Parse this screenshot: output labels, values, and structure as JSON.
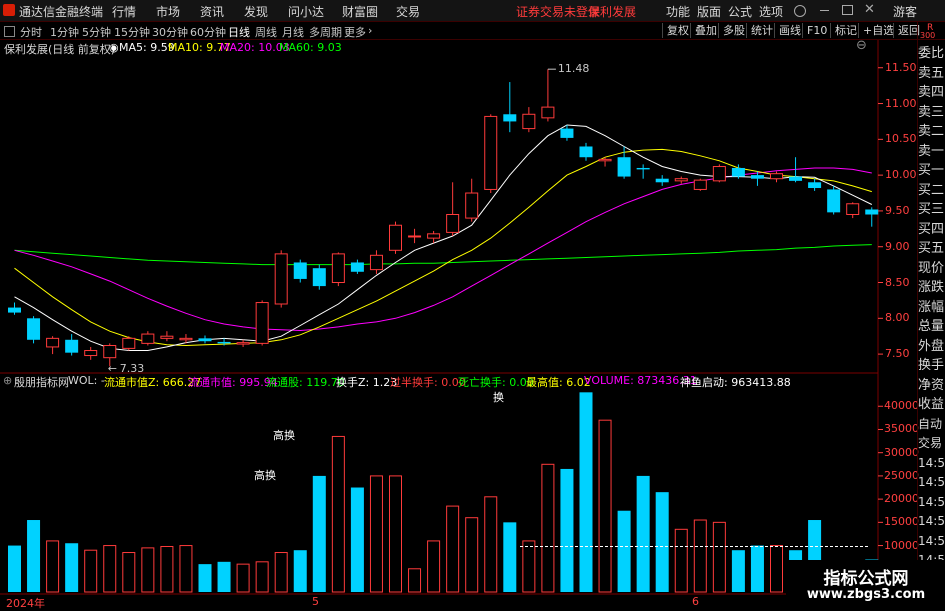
{
  "app": {
    "title": "通达信金融终端",
    "guest_label": "游客"
  },
  "menu": [
    "行情",
    "市场",
    "资讯",
    "发现",
    "问小达",
    "财富圈",
    "交易"
  ],
  "notice": {
    "text": "证券交易未登录",
    "stock": "保利发展"
  },
  "top_right_menu": [
    "功能",
    "版面",
    "公式",
    "选项"
  ],
  "toolbar": {
    "periods": [
      "分时",
      "1分钟",
      "5分钟",
      "15分钟",
      "30分钟",
      "60分钟",
      "日线",
      "周线",
      "月线",
      "多周期",
      "更多"
    ],
    "active_period": "日线",
    "right_buttons": [
      "复权",
      "叠加",
      "多股",
      "统计",
      "画线",
      "F10",
      "标记",
      "+自选",
      "返回"
    ]
  },
  "colors": {
    "up": "#ff3b3b",
    "down": "#00d2ff",
    "ma5": "#ffffff",
    "ma10": "#ffff00",
    "ma20": "#ff00ff",
    "ma60": "#00ff00"
  },
  "main_legend": {
    "title": "保利发展(日线 前复权)",
    "ma5": "MA5: 9.59",
    "ma10": "MA10: 9.77",
    "ma20": "MA20: 10.03",
    "ma60": "MA60: 9.03"
  },
  "price_marks": {
    "high": "11.48",
    "low": "7.33"
  },
  "right_panel": {
    "top_label": "R",
    "top_sub": "300",
    "labels": [
      "委比",
      "卖五",
      "卖四",
      "卖三",
      "卖二",
      "卖一",
      "买一",
      "买二",
      "买三",
      "买四",
      "买五",
      "现价",
      "涨跌",
      "涨幅",
      "总量",
      "外盘",
      "换手",
      "净资",
      "收益",
      "自动",
      "交易",
      "14:56",
      "14:56",
      "14:56",
      "14:56",
      "14:56",
      "14:56",
      "14:56",
      "14:56"
    ]
  },
  "indicator_legend": {
    "name": "殷朋指标网",
    "wol": "WOL: -",
    "items": [
      {
        "label": "流通市值Z: 666.27",
        "color": "#ffff00"
      },
      {
        "label": "流通市值: 995.94",
        "color": "#ff00ff"
      },
      {
        "label": "流通股: 119.70",
        "color": "#00ff00"
      },
      {
        "label": "换手Z: 1.23",
        "color": "#ffffff"
      },
      {
        "label": "过半换手: 0.00",
        "color": "#ff3b3b"
      },
      {
        "label": "死亡换手: 0.00",
        "color": "#00ff00"
      },
      {
        "label": "最高值: 6.02",
        "color": "#ffff00"
      },
      {
        "label": "VOLUME: 873436.31",
        "color": "#ff00ff"
      },
      {
        "label": "神鱼启动: 963413.88",
        "color": "#ffffff"
      }
    ]
  },
  "volume_labels": {
    "gaohuan1": "高换",
    "gaohuan2": "高换",
    "gaohuan3": "换"
  },
  "date_labels": [
    "2024年",
    "5",
    "6"
  ],
  "watermark": {
    "title": "指标公式网",
    "url": "www.zbgs3.com"
  },
  "chart_data": {
    "type": "candlestick",
    "price_ticks": [
      11.5,
      11.0,
      10.5,
      10.0,
      9.5,
      9.0,
      8.5,
      8.0,
      7.5
    ],
    "volume_ticks": [
      40000,
      35000,
      30000,
      25000,
      20000,
      15000,
      10000
    ],
    "candles": [
      {
        "o": 8.15,
        "h": 8.22,
        "l": 8.05,
        "c": 8.08
      },
      {
        "o": 8.0,
        "h": 8.03,
        "l": 7.65,
        "c": 7.7
      },
      {
        "o": 7.6,
        "h": 7.75,
        "l": 7.5,
        "c": 7.72
      },
      {
        "o": 7.7,
        "h": 7.78,
        "l": 7.48,
        "c": 7.52
      },
      {
        "o": 7.48,
        "h": 7.6,
        "l": 7.42,
        "c": 7.55
      },
      {
        "o": 7.45,
        "h": 7.65,
        "l": 7.33,
        "c": 7.62
      },
      {
        "o": 7.58,
        "h": 7.75,
        "l": 7.55,
        "c": 7.72
      },
      {
        "o": 7.65,
        "h": 7.82,
        "l": 7.62,
        "c": 7.78
      },
      {
        "o": 7.72,
        "h": 7.82,
        "l": 7.68,
        "c": 7.75
      },
      {
        "o": 7.7,
        "h": 7.78,
        "l": 7.65,
        "c": 7.72
      },
      {
        "o": 7.72,
        "h": 7.76,
        "l": 7.65,
        "c": 7.68
      },
      {
        "o": 7.67,
        "h": 7.72,
        "l": 7.62,
        "c": 7.65
      },
      {
        "o": 7.64,
        "h": 7.7,
        "l": 7.6,
        "c": 7.66
      },
      {
        "o": 7.65,
        "h": 8.25,
        "l": 7.62,
        "c": 8.22
      },
      {
        "o": 8.2,
        "h": 8.95,
        "l": 8.15,
        "c": 8.9
      },
      {
        "o": 8.78,
        "h": 8.82,
        "l": 8.5,
        "c": 8.55
      },
      {
        "o": 8.7,
        "h": 8.75,
        "l": 8.4,
        "c": 8.45
      },
      {
        "o": 8.5,
        "h": 8.92,
        "l": 8.45,
        "c": 8.9
      },
      {
        "o": 8.78,
        "h": 8.82,
        "l": 8.62,
        "c": 8.65
      },
      {
        "o": 8.68,
        "h": 8.95,
        "l": 8.62,
        "c": 8.88
      },
      {
        "o": 8.95,
        "h": 9.35,
        "l": 8.9,
        "c": 9.3
      },
      {
        "o": 9.15,
        "h": 9.25,
        "l": 9.05,
        "c": 9.15
      },
      {
        "o": 9.12,
        "h": 9.22,
        "l": 9.05,
        "c": 9.18
      },
      {
        "o": 9.2,
        "h": 9.9,
        "l": 9.15,
        "c": 9.45
      },
      {
        "o": 9.4,
        "h": 9.95,
        "l": 9.35,
        "c": 9.75
      },
      {
        "o": 9.8,
        "h": 10.85,
        "l": 9.75,
        "c": 10.82
      },
      {
        "o": 10.85,
        "h": 11.3,
        "l": 10.6,
        "c": 10.75
      },
      {
        "o": 10.65,
        "h": 10.95,
        "l": 10.6,
        "c": 10.85
      },
      {
        "o": 10.8,
        "h": 11.48,
        "l": 10.75,
        "c": 10.95
      },
      {
        "o": 10.65,
        "h": 10.7,
        "l": 10.48,
        "c": 10.52
      },
      {
        "o": 10.4,
        "h": 10.45,
        "l": 10.2,
        "c": 10.25
      },
      {
        "o": 10.2,
        "h": 10.25,
        "l": 10.12,
        "c": 10.22
      },
      {
        "o": 10.25,
        "h": 10.4,
        "l": 9.95,
        "c": 9.98
      },
      {
        "o": 10.1,
        "h": 10.15,
        "l": 9.95,
        "c": 10.08
      },
      {
        "o": 9.95,
        "h": 10.0,
        "l": 9.85,
        "c": 9.9
      },
      {
        "o": 9.92,
        "h": 9.98,
        "l": 9.88,
        "c": 9.95
      },
      {
        "o": 9.8,
        "h": 9.95,
        "l": 9.78,
        "c": 9.93
      },
      {
        "o": 9.92,
        "h": 10.15,
        "l": 9.9,
        "c": 10.12
      },
      {
        "o": 10.1,
        "h": 10.15,
        "l": 9.95,
        "c": 9.98
      },
      {
        "o": 10.0,
        "h": 10.05,
        "l": 9.85,
        "c": 9.95
      },
      {
        "o": 9.95,
        "h": 10.05,
        "l": 9.9,
        "c": 10.02
      },
      {
        "o": 9.98,
        "h": 10.25,
        "l": 9.9,
        "c": 9.92
      },
      {
        "o": 9.9,
        "h": 9.95,
        "l": 9.78,
        "c": 9.82
      },
      {
        "o": 9.8,
        "h": 9.85,
        "l": 9.45,
        "c": 9.48
      },
      {
        "o": 9.45,
        "h": 9.62,
        "l": 9.4,
        "c": 9.6
      },
      {
        "o": 9.52,
        "h": 9.55,
        "l": 9.28,
        "c": 9.45
      }
    ],
    "volume": [
      10000,
      15500,
      11000,
      10500,
      9000,
      10000,
      8500,
      9500,
      9800,
      10000,
      6000,
      6500,
      6000,
      6500,
      8500,
      9000,
      25000,
      33500,
      22500,
      25000,
      25000,
      5000,
      11000,
      18500,
      16000,
      20500,
      15000,
      11000,
      27500,
      26500,
      43000,
      37000,
      17500,
      25000,
      21500,
      13500,
      15500,
      15000,
      9000,
      10000,
      10000,
      9000,
      15500,
      6000,
      6000,
      7000
    ],
    "ma_lines": {
      "ma5": [
        8.3,
        8.15,
        7.98,
        7.82,
        7.68,
        7.58,
        7.55,
        7.55,
        7.6,
        7.66,
        7.7,
        7.72,
        7.7,
        7.68,
        7.75,
        7.9,
        8.05,
        8.2,
        8.4,
        8.6,
        8.78,
        8.95,
        9.05,
        9.15,
        9.3,
        9.65,
        10.0,
        10.3,
        10.55,
        10.7,
        10.68,
        10.55,
        10.4,
        10.25,
        10.12,
        10.05,
        10.0,
        9.98,
        9.98,
        9.97,
        9.95,
        9.98,
        9.97,
        9.85,
        9.72,
        9.59
      ],
      "ma10": [
        8.7,
        8.5,
        8.3,
        8.12,
        7.95,
        7.82,
        7.73,
        7.67,
        7.63,
        7.62,
        7.63,
        7.64,
        7.65,
        7.66,
        7.7,
        7.77,
        7.88,
        8.0,
        8.12,
        8.24,
        8.38,
        8.52,
        8.66,
        8.82,
        8.95,
        9.12,
        9.33,
        9.55,
        9.78,
        10.0,
        10.12,
        10.25,
        10.32,
        10.35,
        10.36,
        10.33,
        10.27,
        10.2,
        10.1,
        10.05,
        10.0,
        9.98,
        9.95,
        9.92,
        9.85,
        9.77
      ],
      "ma20": [
        8.95,
        8.88,
        8.8,
        8.72,
        8.62,
        8.52,
        8.4,
        8.28,
        8.17,
        8.07,
        7.98,
        7.92,
        7.88,
        7.85,
        7.84,
        7.83,
        7.85,
        7.88,
        7.92,
        7.95,
        8.0,
        8.08,
        8.18,
        8.3,
        8.45,
        8.6,
        8.75,
        8.9,
        9.05,
        9.2,
        9.35,
        9.48,
        9.6,
        9.7,
        9.8,
        9.87,
        9.92,
        9.96,
        10.0,
        10.03,
        10.06,
        10.08,
        10.1,
        10.1,
        10.08,
        10.03
      ],
      "ma60": [
        8.95,
        8.93,
        8.91,
        8.89,
        8.87,
        8.85,
        8.83,
        8.81,
        8.8,
        8.79,
        8.78,
        8.77,
        8.76,
        8.75,
        8.75,
        8.75,
        8.75,
        8.75,
        8.75,
        8.76,
        8.76,
        8.77,
        8.77,
        8.78,
        8.79,
        8.8,
        8.81,
        8.82,
        8.83,
        8.84,
        8.85,
        8.86,
        8.87,
        8.88,
        8.89,
        8.9,
        8.91,
        8.92,
        8.94,
        8.95,
        8.96,
        8.98,
        8.99,
        9.01,
        9.02,
        9.03
      ]
    }
  }
}
